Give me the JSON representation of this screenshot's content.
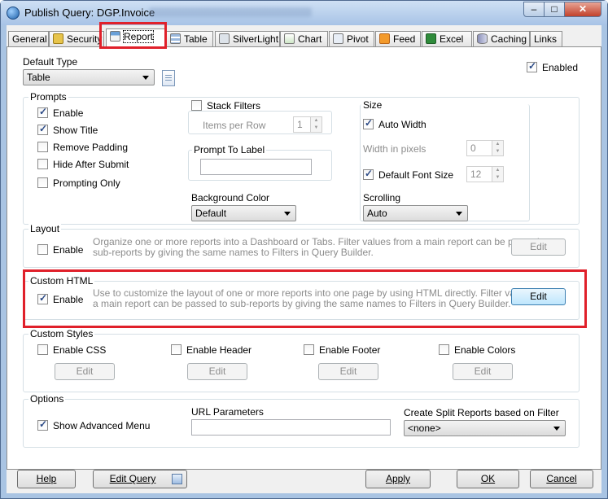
{
  "window": {
    "title": "Publish Query: DGP.Invoice"
  },
  "tabs": [
    {
      "label": "General",
      "icon": "none"
    },
    {
      "label": "Security",
      "icon": "lock-icon"
    },
    {
      "label": "Report",
      "icon": "report-icon"
    },
    {
      "label": "Table",
      "icon": "table-icon"
    },
    {
      "label": "SilverLight",
      "icon": "silverlight-icon"
    },
    {
      "label": "Chart",
      "icon": "chart-icon"
    },
    {
      "label": "Pivot",
      "icon": "pivot-icon"
    },
    {
      "label": "Feed",
      "icon": "rss-icon"
    },
    {
      "label": "Excel",
      "icon": "excel-icon"
    },
    {
      "label": "Caching",
      "icon": "database-icon"
    },
    {
      "label": "Links",
      "icon": "none"
    }
  ],
  "report": {
    "default_type_label": "Default Type",
    "default_type_value": "Table",
    "enabled_label": "Enabled",
    "prompts": {
      "title": "Prompts",
      "items": [
        {
          "label": "Enable",
          "checked": true
        },
        {
          "label": "Show Title",
          "checked": true
        },
        {
          "label": "Remove Padding",
          "checked": false
        },
        {
          "label": "Hide After Submit",
          "checked": false
        },
        {
          "label": "Prompting Only",
          "checked": false
        }
      ],
      "stack_filters_label": "Stack Filters",
      "items_per_row_label": "Items per Row",
      "items_per_row_value": "1",
      "prompt_to_label_title": "Prompt To Label",
      "background_color_label": "Background Color",
      "background_color_value": "Default"
    },
    "size": {
      "title": "Size",
      "auto_width_label": "Auto Width",
      "width_in_pixels_label": "Width in pixels",
      "width_value": "0",
      "default_font_size_label": "Default Font Size",
      "font_size_value": "12",
      "scrolling_label": "Scrolling",
      "scrolling_value": "Auto"
    },
    "layout": {
      "title": "Layout",
      "enable_label": "Enable",
      "description_line1": "Organize one or more reports into a Dashboard or Tabs. Filter values from a main report can be passed to",
      "description_line2": "sub-reports by giving the same names to Filters in Query Builder.",
      "edit_label": "Edit"
    },
    "custom_html": {
      "title": "Custom HTML",
      "enable_label": "Enable",
      "description_line1": "Use to customize the layout of one or more reports into one page by using HTML directly. Filter values from",
      "description_line2": "a main report can be passed to sub-reports by giving the same names to Filters in Query Builder.",
      "edit_label": "Edit"
    },
    "custom_styles": {
      "title": "Custom Styles",
      "items": [
        {
          "label": "Enable CSS",
          "edit": "Edit"
        },
        {
          "label": "Enable Header",
          "edit": "Edit"
        },
        {
          "label": "Enable Footer",
          "edit": "Edit"
        },
        {
          "label": "Enable Colors",
          "edit": "Edit"
        }
      ]
    },
    "options": {
      "title": "Options",
      "show_advanced_menu_label": "Show Advanced Menu",
      "url_parameters_label": "URL Parameters",
      "split_reports_label": "Create Split Reports based on Filter",
      "split_reports_value": "<none>"
    }
  },
  "footer": {
    "help": "Help",
    "edit_query": "Edit Query",
    "apply": "Apply",
    "ok": "OK",
    "cancel": "Cancel"
  }
}
